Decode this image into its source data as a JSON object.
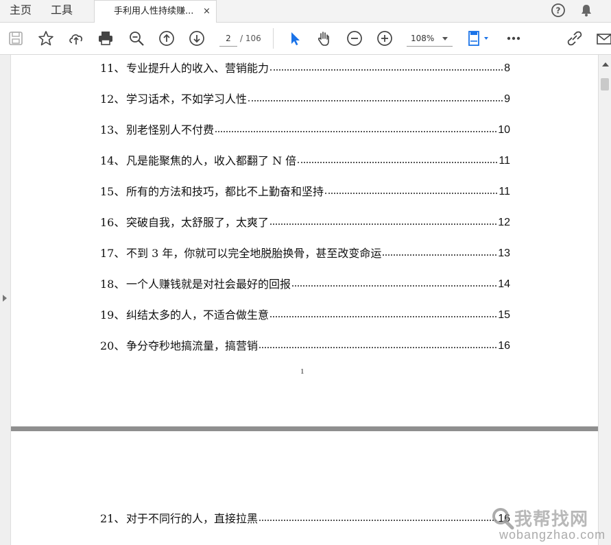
{
  "tabs": {
    "home_label": "主页",
    "tools_label": "工具",
    "document_title": "手利用人性持续赚...",
    "close_glyph": "×"
  },
  "toolbar": {
    "current_page": "2",
    "total_pages": "/ 106",
    "zoom_level": "108%"
  },
  "icons": {
    "accent": "#1a73e8",
    "names": [
      "save-icon",
      "bookmark-star-icon",
      "upload-cloud-icon",
      "print-icon",
      "zoom-out-search-icon",
      "prev-page-icon",
      "next-page-icon",
      "select-cursor-icon",
      "hand-tool-icon",
      "zoom-out-icon",
      "zoom-in-icon",
      "page-fit-icon",
      "more-icon",
      "share-link-icon",
      "mail-icon",
      "help-icon",
      "bell-icon"
    ]
  },
  "page1": {
    "toc": [
      {
        "num": "11、",
        "title": "专业提升人的收入、营销能力",
        "page": "8"
      },
      {
        "num": "12、",
        "title": "学习话术，不如学习人性",
        "page": "9"
      },
      {
        "num": "13、",
        "title": "别老怪别人不付费",
        "page": "10"
      },
      {
        "num": "14、",
        "title": "凡是能聚焦的人，收入都翻了 N 倍",
        "page": "11"
      },
      {
        "num": "15、",
        "title": "所有的方法和技巧，都比不上勤奋和坚持",
        "page": "11"
      },
      {
        "num": "16、",
        "title": "突破自我，太舒服了，太爽了",
        "page": "12"
      },
      {
        "num": "17、",
        "title": "不到 3 年，你就可以完全地脱胎换骨，甚至改变命运",
        "page": "13"
      },
      {
        "num": "18、",
        "title": "一个人赚钱就是对社会最好的回报",
        "page": "14"
      },
      {
        "num": "19、",
        "title": "纠结太多的人，不适合做生意",
        "page": "15"
      },
      {
        "num": "20、",
        "title": " 争分夺秒地搞流量，搞营销",
        "page": "16"
      }
    ],
    "page_number": "1"
  },
  "page2": {
    "toc": [
      {
        "num": "21、",
        "title": "对于不同行的人，直接拉黑",
        "page": "16"
      }
    ]
  },
  "watermark": {
    "text": "我帮找网",
    "url": "wobangzhao.com"
  }
}
